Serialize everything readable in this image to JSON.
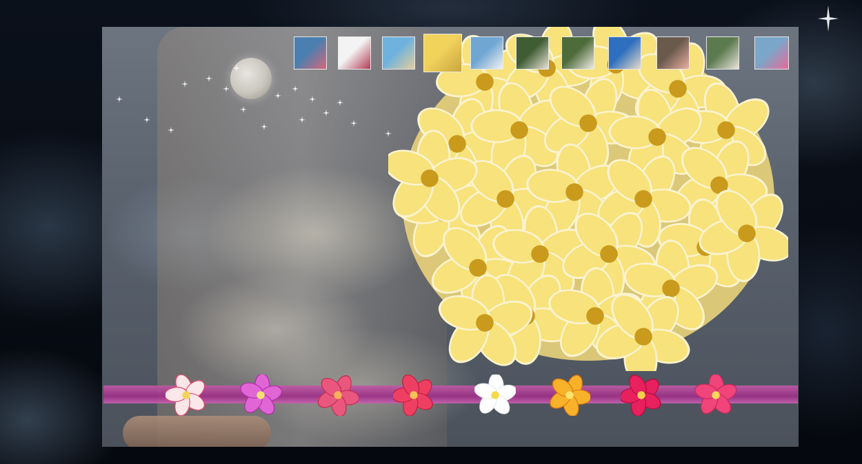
{
  "colors": {
    "ribbon": "#a33a8d",
    "petal_yellow": "#f4dc6a",
    "panel_overlay": "#5f6772"
  },
  "thumbnails": [
    {
      "name": "bouquet-on-shore",
      "c1": "#4a7fb0",
      "c2": "#d9667a"
    },
    {
      "name": "couple-embrace",
      "c1": "#f3f3f3",
      "c2": "#b23a55"
    },
    {
      "name": "beach-arch",
      "c1": "#6fb2de",
      "c2": "#e2cc9a"
    },
    {
      "name": "yellow-bouquet",
      "c1": "#f1d35c",
      "c2": "#c9a640"
    },
    {
      "name": "bride-veil",
      "c1": "#6fa6d2",
      "c2": "#f2f2f2"
    },
    {
      "name": "bride-portrait",
      "c1": "#3f5c33",
      "c2": "#e9e1d8"
    },
    {
      "name": "couple-garden",
      "c1": "#4e6b3a",
      "c2": "#f0ece6"
    },
    {
      "name": "wedding-kiss",
      "c1": "#2f6fc0",
      "c2": "#e8dcc8"
    },
    {
      "name": "bride-closeup",
      "c1": "#6a5a4c",
      "c2": "#e8b0a2"
    },
    {
      "name": "lei-kiss",
      "c1": "#5c7a4f",
      "c2": "#e9e4dc"
    },
    {
      "name": "pink-bouquet-beach",
      "c1": "#7aa7c9",
      "c2": "#e86a9a"
    }
  ],
  "flowers": [
    {
      "name": "white-pink-plumeria",
      "petal": "#fbe6ea",
      "edge": "#e04a6e",
      "center": "#f3d35a"
    },
    {
      "name": "magenta-plumeria",
      "petal": "#e066d6",
      "edge": "#b02eaa",
      "center": "#f2e26a"
    },
    {
      "name": "rose-plumeria",
      "petal": "#e9567e",
      "edge": "#c0304f",
      "center": "#f6b15a"
    },
    {
      "name": "red-plumeria",
      "petal": "#ee3f63",
      "edge": "#c0213f",
      "center": "#f6c05a"
    },
    {
      "name": "white-plumeria",
      "petal": "#ffffff",
      "edge": "#eaeaea",
      "center": "#f5d94a"
    },
    {
      "name": "orange-plumeria",
      "petal": "#f7b22a",
      "edge": "#e07a10",
      "center": "#fde36a"
    },
    {
      "name": "crimson-plumeria",
      "petal": "#e8205e",
      "edge": "#b0103e",
      "center": "#f7cf4a"
    },
    {
      "name": "pink-plumeria",
      "petal": "#f0447a",
      "edge": "#c9295a",
      "center": "#f8d65a"
    }
  ]
}
